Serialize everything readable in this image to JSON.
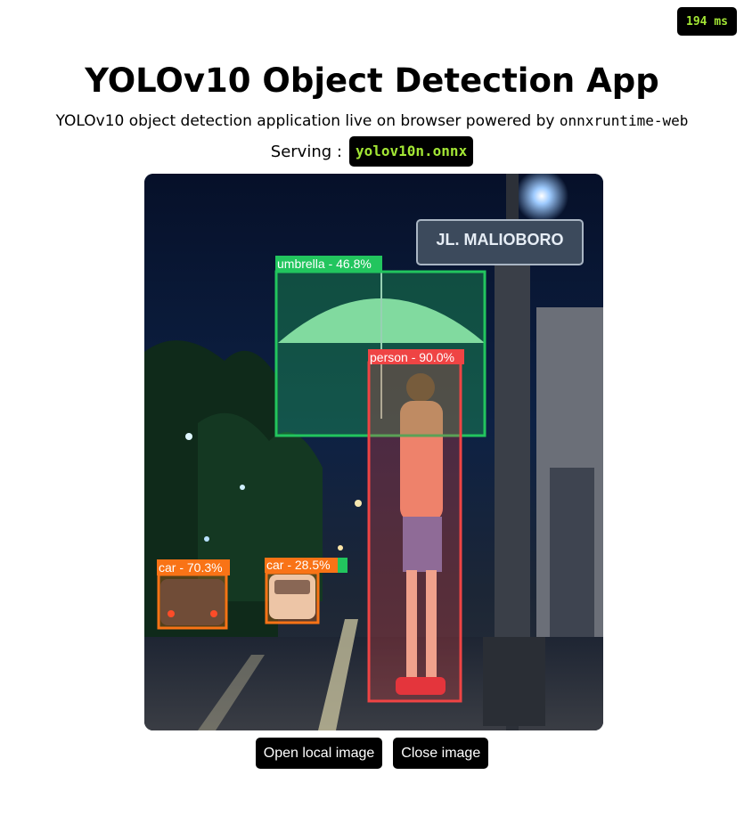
{
  "timer": {
    "text": "194 ms"
  },
  "header": {
    "title": "YOLOv10 Object Detection App",
    "subtitle_text": "YOLOv10 object detection application live on browser powered by",
    "subtitle_code": "onnxruntime-web",
    "serving_label": "Serving :",
    "model_name": "yolov10n.onnx"
  },
  "image": {
    "street_sign": "JL. MALIOBORO",
    "detections": [
      {
        "label": "umbrella - 46.8%",
        "color": "#22c55e"
      },
      {
        "label": "person - 90.0%",
        "color": "#ef4444"
      },
      {
        "label": "car - 70.3%",
        "color": "#f97316"
      },
      {
        "label": "car - 28.5%",
        "color": "#f97316"
      }
    ]
  },
  "buttons": {
    "open_label": "Open local image",
    "close_label": "Close image"
  }
}
